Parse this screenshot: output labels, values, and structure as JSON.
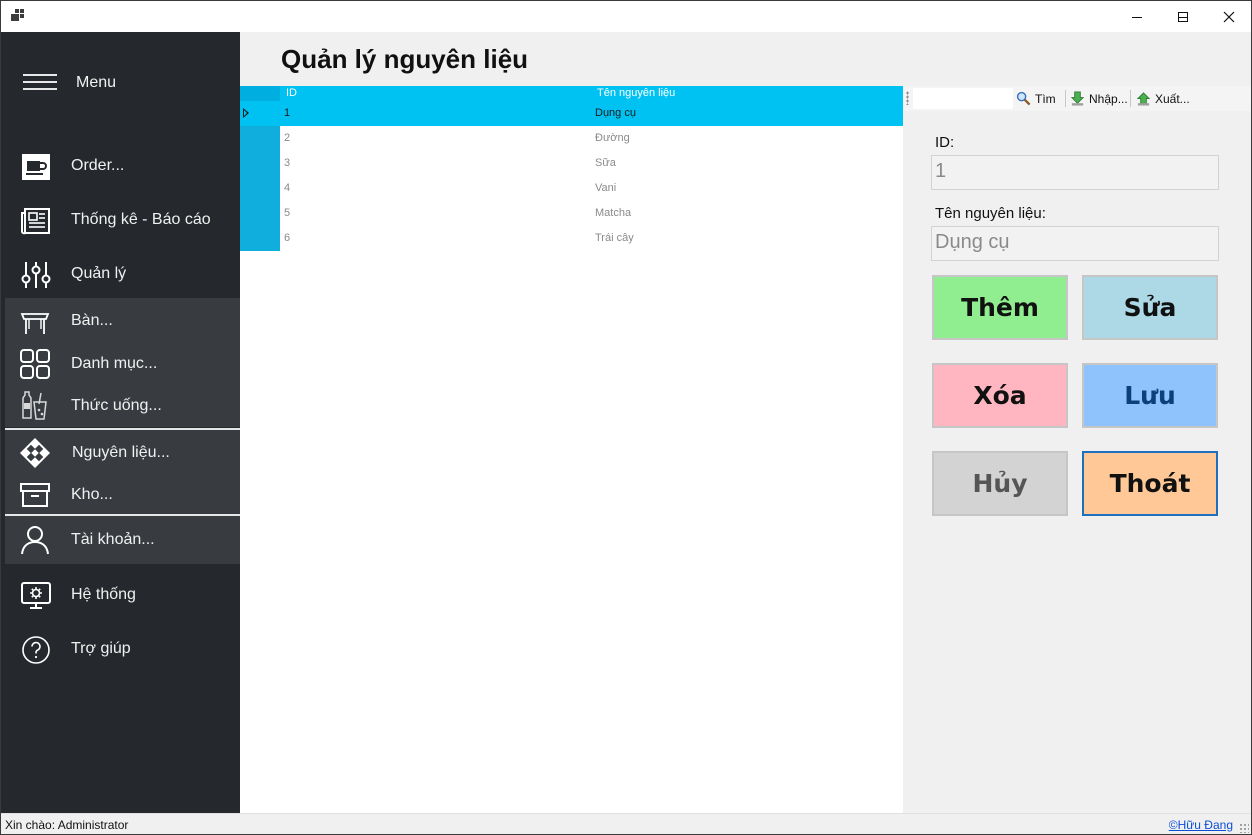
{
  "window": {
    "minimize_icon": "minimize-icon",
    "maximize_icon": "maximize-icon",
    "close_icon": "close-icon"
  },
  "sidebar": {
    "menu_label": "Menu",
    "items": [
      {
        "label": "Order...",
        "icon": "coffee-cup-icon"
      },
      {
        "label": "Thống kê - Báo cáo",
        "icon": "newspaper-icon"
      },
      {
        "label": "Quản lý",
        "icon": "sliders-icon"
      }
    ],
    "sub_items": [
      {
        "label": "Bàn...",
        "icon": "table-icon"
      },
      {
        "label": "Danh mục...",
        "icon": "category-grid-icon"
      },
      {
        "label": "Thức uống...",
        "icon": "drinks-icon"
      },
      {
        "label": "Nguyên liệu...",
        "icon": "ingredient-icon"
      },
      {
        "label": "Kho...",
        "icon": "archive-box-icon"
      },
      {
        "label": "Tài khoản...",
        "icon": "user-icon"
      }
    ],
    "bottom_items": [
      {
        "label": "Hệ thống",
        "icon": "system-monitor-icon"
      },
      {
        "label": "Trợ giúp",
        "icon": "help-icon"
      }
    ],
    "colors": {
      "background": "#25292d",
      "submenu_background": "#383c41"
    }
  },
  "main": {
    "title": "Quản lý nguyên liệu"
  },
  "grid": {
    "columns": [
      "ID",
      "Tên nguyên liệu"
    ],
    "rows": [
      [
        "1",
        "Dụng cụ"
      ],
      [
        "2",
        "Đường"
      ],
      [
        "3",
        "Sữa"
      ],
      [
        "4",
        "Vani"
      ],
      [
        "5",
        "Matcha"
      ],
      [
        "6",
        "Trái cây"
      ]
    ],
    "selected_row": 0,
    "colors": {
      "header": "#00c2f2",
      "selection": "#00c2f2"
    }
  },
  "toolbar": {
    "search_value": "",
    "search_label": "Tìm",
    "import_label": "Nhập...",
    "export_label": "Xuất..."
  },
  "form": {
    "id_label": "ID:",
    "id_value": "1",
    "name_label": "Tên nguyên liệu:",
    "name_value": "Dụng cụ"
  },
  "buttons": {
    "add": "Thêm",
    "edit": "Sửa",
    "delete": "Xóa",
    "save": "Lưu",
    "cancel": "Hủy",
    "exit": "Thoát",
    "colors": {
      "add": "#90ee90",
      "edit": "#add8e6",
      "delete": "#ffb6c1",
      "save": "#8fc3fb",
      "cancel": "#d3d3d3",
      "exit": "#ffc896"
    }
  },
  "status": {
    "greeting": "Xin chào: Administrator",
    "author_link": "©Hữu Đang"
  }
}
